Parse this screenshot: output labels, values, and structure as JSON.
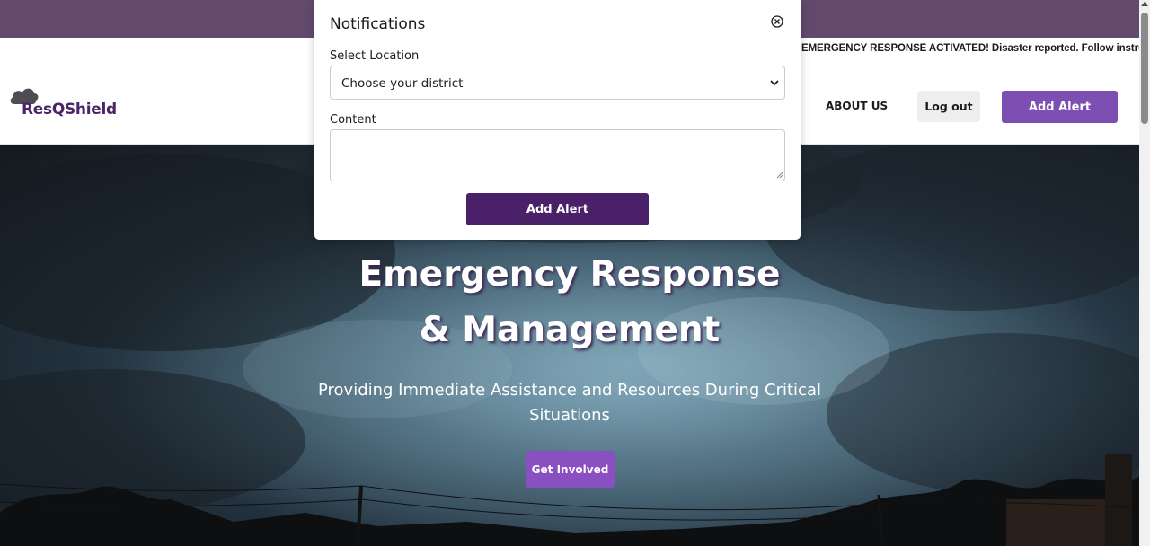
{
  "ticker": {
    "text": "EMERGENCY RESPONSE ACTIVATED! Disaster reported. Follow instruc"
  },
  "nav": {
    "logo_text": "ResQShield",
    "about_label": "ABOUT US",
    "logout_label": "Log out",
    "add_alert_label": "Add Alert"
  },
  "hero": {
    "title_line1": "Emergency Response",
    "title_line2": "& Management",
    "subtitle": "Providing Immediate Assistance and Resources During Critical Situations",
    "cta_label": "Get Involved"
  },
  "modal": {
    "title": "Notifications",
    "location_label": "Select Location",
    "location_selected": "Choose your district",
    "content_label": "Content",
    "content_value": "",
    "submit_label": "Add Alert"
  },
  "colors": {
    "topbar": "#634a6c",
    "brand_purple": "#7e4fb3",
    "modal_button": "#4a2068",
    "logo_text": "#4a2568"
  }
}
